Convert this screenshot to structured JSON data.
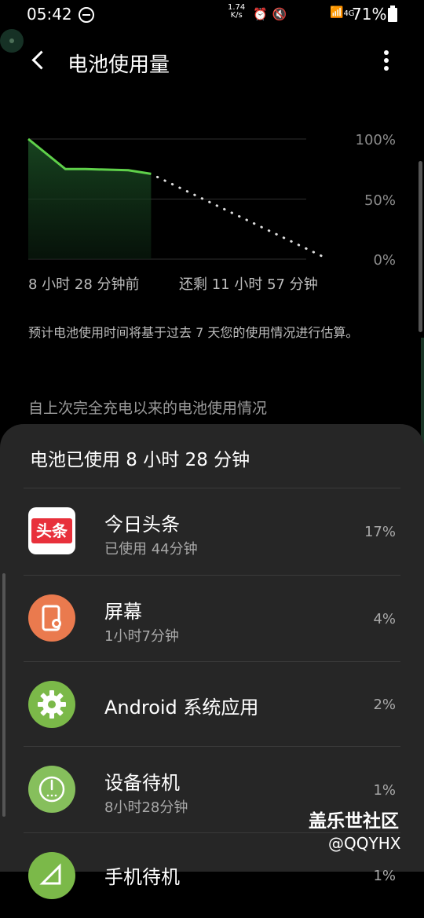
{
  "status_bar": {
    "time": "05:42",
    "speed_value": "1.74",
    "speed_unit": "K/s",
    "signal_label": "4G",
    "battery_text": "71%"
  },
  "header": {
    "title": "电池使用量"
  },
  "chart": {
    "ytick_100": "100%",
    "ytick_50": "50%",
    "ytick_0": "0%",
    "left_label": "8 小时 28 分钟前",
    "right_label": "还剩 11 小时 57 分钟"
  },
  "chart_data": {
    "type": "area",
    "title": "",
    "xlabel": "",
    "ylabel": "",
    "ylim": [
      0,
      100
    ],
    "yticks": [
      "100%",
      "50%",
      "0%"
    ],
    "history": {
      "x_hours": [
        0,
        1.3,
        2,
        3.5,
        4.3
      ],
      "values": [
        100,
        75,
        75,
        74,
        71
      ]
    },
    "projection": {
      "x_hours": [
        4.3,
        10.5
      ],
      "values": [
        71,
        0
      ]
    },
    "x_range_hours": [
      0,
      10.5
    ],
    "line_color": "#5fd04a"
  },
  "description": "预计电池使用时间将基于过去 7 天您的使用情况进行估算。",
  "section_title": "自上次完全充电以来的电池使用情况",
  "sheet": {
    "title": "电池已使用 8 小时 28 分钟",
    "items": [
      {
        "name": "今日头条",
        "sub": "已使用 44分钟",
        "pct": "17%",
        "icon": "toutiao-app-icon",
        "icon_text": "头条"
      },
      {
        "name": "屏幕",
        "sub": "1小时7分钟",
        "pct": "4%",
        "icon": "screen-brightness-icon"
      },
      {
        "name": "Android 系统应用",
        "sub": "",
        "pct": "2%",
        "icon": "gear-icon"
      },
      {
        "name": "设备待机",
        "sub": "8小时28分钟",
        "pct": "1%",
        "icon": "power-icon"
      },
      {
        "name": "手机待机",
        "sub": "",
        "pct": "1%",
        "icon": "signal-icon"
      }
    ]
  },
  "watermark": {
    "line1": "盖乐世社区",
    "line2": "@QQYHX"
  }
}
